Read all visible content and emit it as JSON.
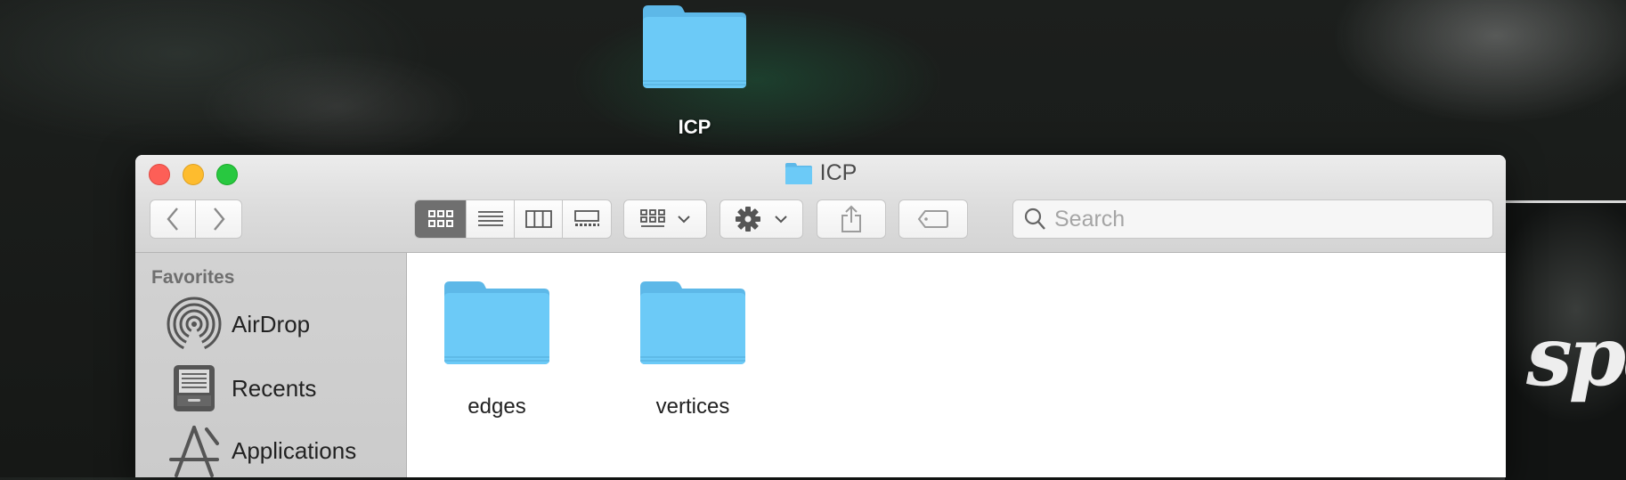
{
  "desktop": {
    "folder_label": "ICP",
    "background_text": "spe"
  },
  "window": {
    "title": "ICP",
    "toolbar": {
      "view_modes": [
        "icon-view",
        "list-view",
        "column-view",
        "gallery-view"
      ],
      "active_view": "icon-view",
      "group_button": "group-by",
      "action_button": "action-menu",
      "share_button": "share",
      "tag_button": "tags"
    },
    "search": {
      "placeholder": "Search",
      "value": ""
    },
    "sidebar": {
      "heading": "Favorites",
      "items": [
        {
          "label": "AirDrop",
          "icon": "airdrop-icon"
        },
        {
          "label": "Recents",
          "icon": "recents-icon"
        },
        {
          "label": "Applications",
          "icon": "applications-icon"
        }
      ]
    },
    "files": [
      {
        "name": "edges",
        "kind": "folder"
      },
      {
        "name": "vertices",
        "kind": "folder"
      }
    ]
  },
  "colors": {
    "folder_blue": "#6ccaf7",
    "close": "#fd5f57",
    "minimize": "#febc2e",
    "maximize": "#28c840",
    "active_segment": "#6f6f6f"
  }
}
